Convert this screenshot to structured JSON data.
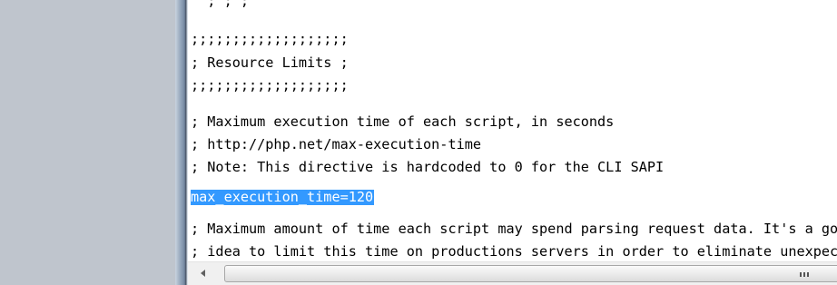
{
  "editor": {
    "lines": [
      "  ; ; ;",
      ";;;;;;;;;;;;;;;;;;;",
      "; Resource Limits ;",
      ";;;;;;;;;;;;;;;;;;;",
      "",
      "; Maximum execution time of each script, in seconds",
      "; http://php.net/max-execution-time",
      "; Note: This directive is hardcoded to 0 for the CLI SAPI",
      "max_execution_time=120",
      "",
      "; Maximum amount of time each script may spend parsing request data. It's a good",
      "; idea to limit this time on productions servers in order to eliminate unexpectedly"
    ],
    "selected_line": "max_execution_time=120"
  },
  "colors": {
    "selection_background": "#3399ff",
    "selection_text": "#ffffff",
    "left_panel": "#bfc5cd",
    "editor_background": "#ffffff"
  },
  "scrollbar": {
    "orientation": "horizontal",
    "left_arrow_icon": "chevron-left-icon",
    "thumb_grip_icon": "grip-lines-icon"
  }
}
